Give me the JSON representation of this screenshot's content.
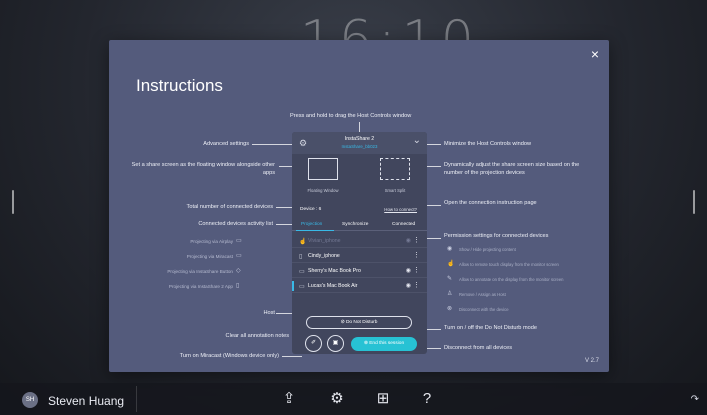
{
  "desktop": {
    "clock": "16:10",
    "user": {
      "initials": "SH",
      "name": "Steven Huang"
    },
    "taskbar_icons": [
      "screen-share-icon",
      "settings-icon",
      "apps-grid-icon",
      "help-icon"
    ]
  },
  "modal": {
    "title": "Instructions",
    "close_label": "×",
    "version": "V 2.7",
    "top_note": "Press and hold to drag the Host Controls window",
    "left_notes": [
      "Advanced settings",
      "Set a share screen as the floating window alongside other apps",
      "Total number of connected devices",
      "Connected devices activity list",
      "Host",
      "Clear all annotation notes",
      "Turn on Miracast (Windows device only)"
    ],
    "right_notes": [
      "Minimize the Host Controls window",
      "Dynamically adjust the share screen size  based on the number of the projection devices",
      "Open the connection instruction page",
      "Permission settings for connected devices",
      "Turn on / off the Do Not Disturb mode",
      "Disconnect from all devices"
    ],
    "projecting_via": [
      "Projecting via Airplay",
      "Projecting via Miracast",
      "Projecting via InstaShare Button",
      "Projecting via InstaShare 2 App"
    ],
    "permissions": [
      "Show / Hide projecting content",
      "Allow to remote touch display from the monitor screen",
      "Allow to annotate on the display from the monitor screen",
      "Remove / Assign as Host",
      "Disconnect with the device"
    ]
  },
  "panel": {
    "title": "InstaShare 2",
    "subtitle": "InstaShare_bb023",
    "modes": [
      "Floating Window",
      "Smart Split"
    ],
    "device_count": "Device : 6",
    "how_to_connect": "How to connect?",
    "tabs": [
      "Projection",
      "Synchronize",
      "Connected"
    ],
    "devices": [
      {
        "name": "Vivian_iphone",
        "dim": true
      },
      {
        "name": "Cindy_iphone",
        "dim": false
      },
      {
        "name": "Sherry's Mac Book Pro",
        "dim": false
      },
      {
        "name": "Lucas's Mac Book Air",
        "dim": false
      }
    ],
    "do_not_disturb": "Do Not Disturb",
    "end_session": "End this session"
  }
}
